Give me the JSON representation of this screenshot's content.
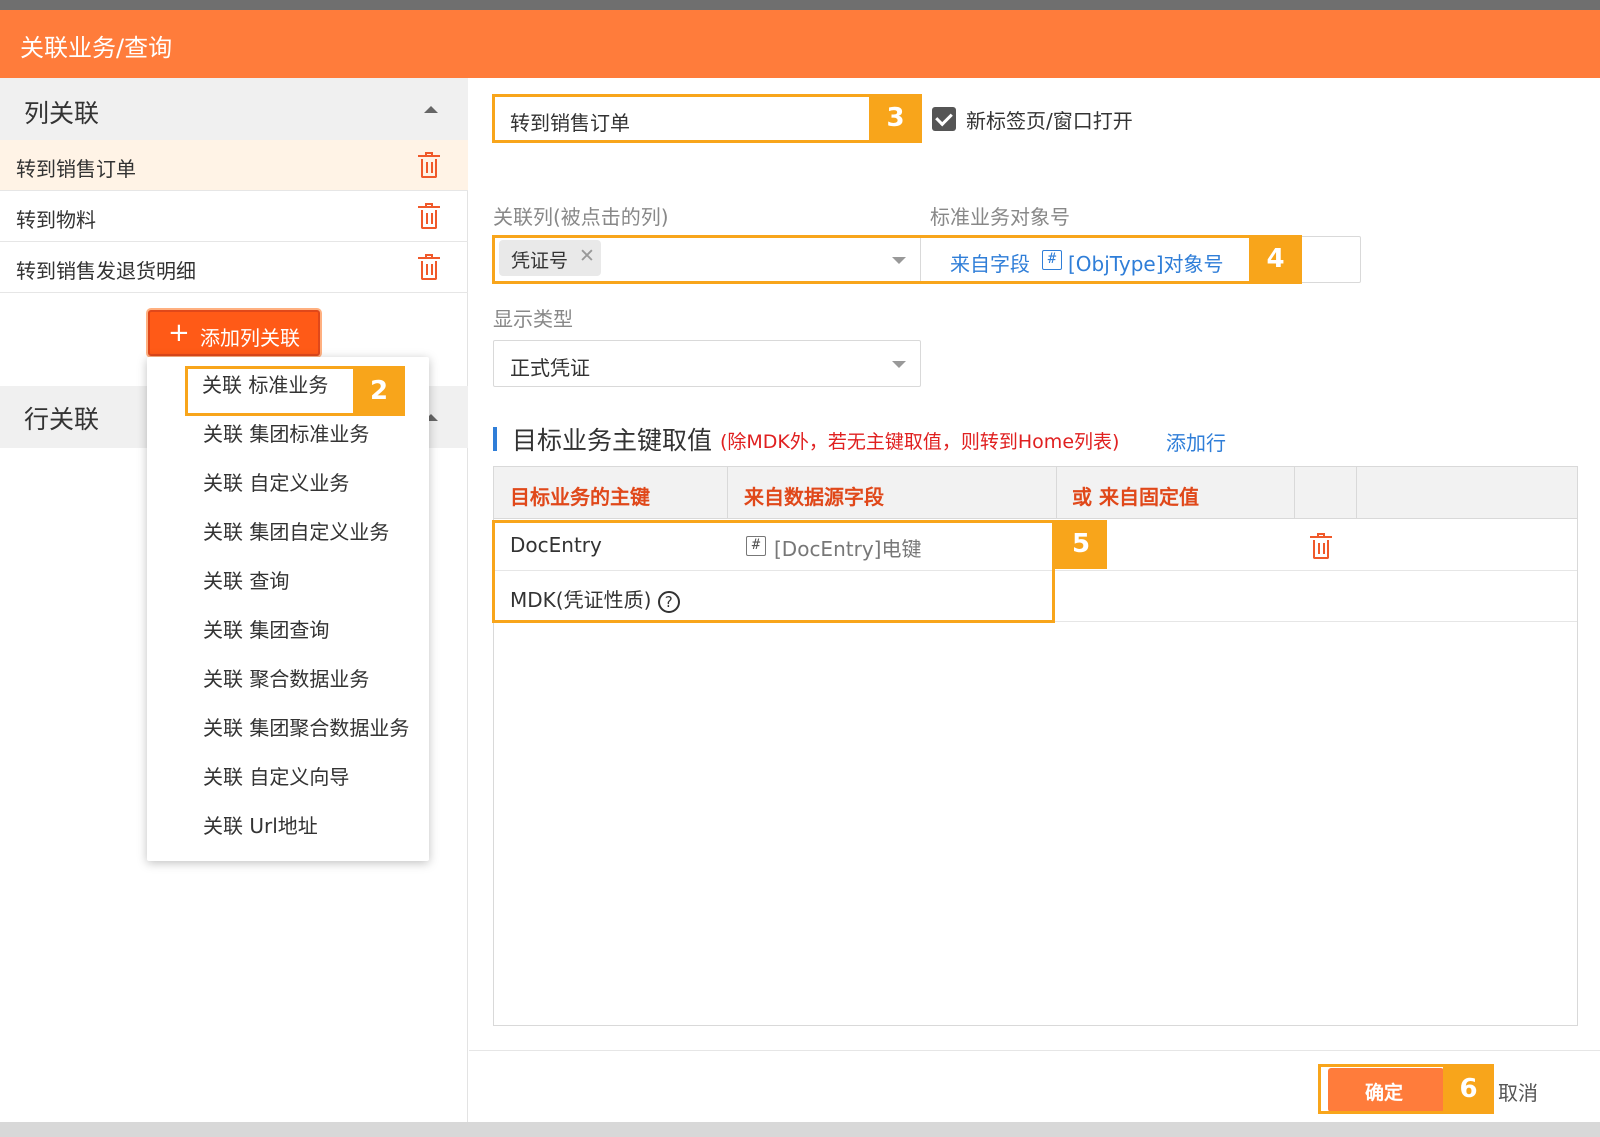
{
  "window": {
    "title": "关联业务/查询"
  },
  "left_panel": {
    "column_section_label": "列关联",
    "column_items": [
      {
        "label": "转到销售订单"
      },
      {
        "label": "转到物料"
      },
      {
        "label": "转到销售发退货明细"
      }
    ],
    "add_button_label": "添加列关联",
    "row_section_label": "行关联",
    "dropdown_items": [
      {
        "label": "关联 标准业务"
      },
      {
        "label": "关联 集团标准业务"
      },
      {
        "label": "关联 自定义业务"
      },
      {
        "label": "关联 集团自定义业务"
      },
      {
        "label": "关联 查询"
      },
      {
        "label": "关联 集团查询"
      },
      {
        "label": "关联 聚合数据业务"
      },
      {
        "label": "关联 集团聚合数据业务"
      },
      {
        "label": "关联 自定义向导"
      },
      {
        "label": "关联 Url地址"
      }
    ]
  },
  "callouts": {
    "step2": "2",
    "step3": "3",
    "step4": "4",
    "step5": "5",
    "step6": "6"
  },
  "form": {
    "name_value": "转到销售订单",
    "new_tab_label": "新标签页/窗口打开",
    "new_tab_checked": true,
    "link_column_label": "关联列(被点击的列)",
    "link_column_tag": "凭证号",
    "target_object_label": "标准业务对象号",
    "target_object_prefix": "来自字段",
    "target_object_value": "[ObjType]对象号",
    "display_type_label": "显示类型",
    "display_type_value": "正式凭证"
  },
  "key_section": {
    "title": "目标业务主键取值",
    "note": "(除MDK外，若无主键取值，则转到Home列表)",
    "add_row_label": "添加行",
    "columns": [
      "目标业务的主键",
      "来自数据源字段",
      "或 来自固定值"
    ],
    "rows": [
      {
        "key": "DocEntry",
        "source": "[DocEntry]电键",
        "fixed": ""
      },
      {
        "key": "MDK(凭证性质)",
        "source": "",
        "fixed": ""
      }
    ]
  },
  "footer": {
    "ok_label": "确定",
    "cancel_label": "取消"
  },
  "colors": {
    "accent": "#ff7c3b",
    "callout": "#f8a51b",
    "link": "#2f7ed8",
    "danger": "#e0481a"
  }
}
